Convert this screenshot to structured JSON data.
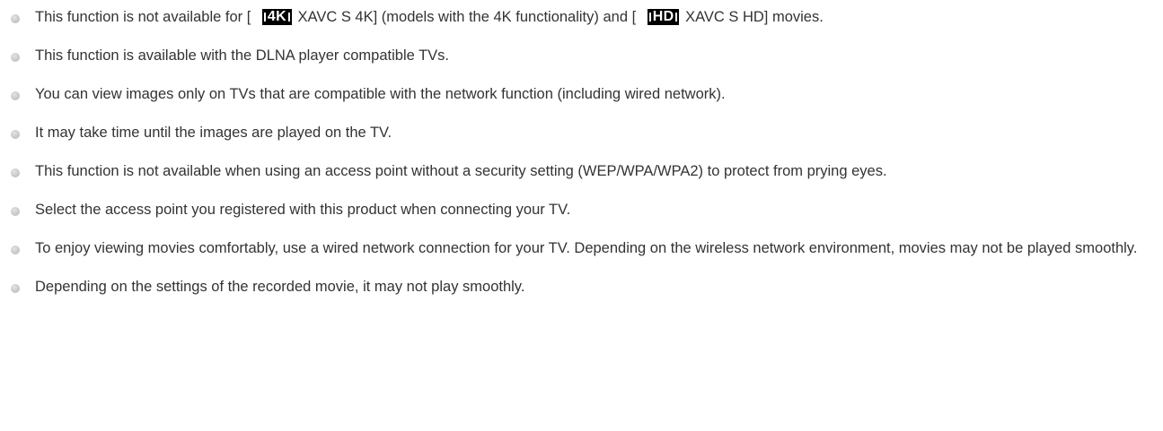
{
  "notes": [
    {
      "before": "This function is not available for [",
      "badge1": "4K",
      "middle": "XAVC S 4K] (models with the 4K functionality) and [",
      "badge2": "HD",
      "after": "XAVC S HD] movies."
    },
    {
      "text": "This function is available with the DLNA player compatible TVs."
    },
    {
      "text": "You can view images only on TVs that are compatible with the network function (including wired network)."
    },
    {
      "text": "It may take time until the images are played on the TV."
    },
    {
      "text": "This function is not available when using an access point without a security setting (WEP/WPA/WPA2) to protect from prying eyes."
    },
    {
      "text": "Select the access point you registered with this product when connecting your TV."
    },
    {
      "text": "To enjoy viewing movies comfortably, use a wired network connection for your TV. Depending on the wireless network environment, movies may not be played smoothly."
    },
    {
      "text": "Depending on the settings of the recorded movie, it may not play smoothly."
    }
  ]
}
